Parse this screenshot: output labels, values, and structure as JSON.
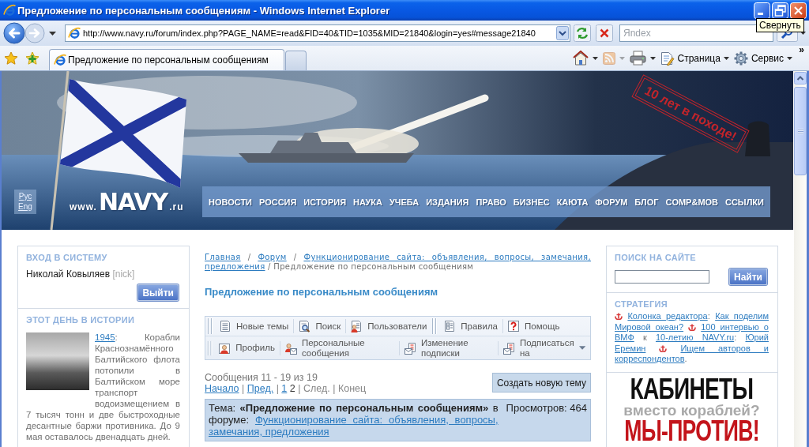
{
  "window": {
    "title": "Предложение по персональным сообщениям - Windows Internet Explorer",
    "tooltip": "Свернуть"
  },
  "address_bar": {
    "url": "http://www.navy.ru/forum/index.php?PAGE_NAME=read&FID=40&TID=1035&MID=21840&login=yes#message21840"
  },
  "search": {
    "placeholder": "Яndex"
  },
  "tabs": [
    {
      "label": "Предложение по персональным сообщениям",
      "selected": true
    }
  ],
  "command_bar": {
    "items": [
      {
        "kind": "home",
        "disabled": false
      },
      {
        "kind": "feeds",
        "disabled": true
      },
      {
        "kind": "print",
        "disabled": false
      },
      {
        "kind": "page",
        "label": "Страница",
        "disabled": false
      },
      {
        "kind": "tools",
        "label": "Сервис",
        "disabled": false
      }
    ],
    "overflow": "»"
  },
  "banner": {
    "stamp": "10 лет в походе!",
    "languages": [
      {
        "label": "Рус"
      },
      {
        "label": "Eng"
      }
    ],
    "logo": {
      "prefix": "www.",
      "name": "NAVY",
      "suffix": ".ru"
    },
    "nav": [
      "НОВОСТИ",
      "РОССИЯ",
      "ИСТОРИЯ",
      "НАУКА",
      "УЧЕБА",
      "ИЗДАНИЯ",
      "ПРАВО",
      "БИЗНЕС",
      "КАЮТА",
      "ФОРУМ",
      "БЛОГ",
      "COMP&MOB",
      "ССЫЛКИ"
    ]
  },
  "left_sidebar": {
    "login": {
      "heading": "ВХОД В СИСТЕМУ",
      "user": "Николай Ковыляев",
      "nick": "[nick]",
      "button": "Выйти"
    },
    "history": {
      "heading": "ЭТОТ ДЕНЬ В ИСТОРИИ",
      "entries": [
        {
          "beside_photo": [
            {
              "kind": "link",
              "text": "1945"
            },
            {
              "kind": "text",
              "text": ": Корабли Краснознамённого Балтийского флота потопили в Балтийском море транспорт водоизмещением в"
            }
          ],
          "below_photo": "7 тысяч тонн и две быстроходные десантные баржи противника. До 9 мая оставалось двенадцать дней."
        }
      ]
    }
  },
  "forum": {
    "breadcrumb": [
      {
        "kind": "link",
        "text": "Главная"
      },
      {
        "kind": "text",
        "text": " / "
      },
      {
        "kind": "link",
        "text": "Форум"
      },
      {
        "kind": "text",
        "text": " / "
      },
      {
        "kind": "link",
        "text": "Функционирование сайта: объявления, вопросы, замечания,"
      },
      {
        "kind": "link",
        "text": "предложения"
      },
      {
        "kind": "text",
        "text": " / Предложение по персональным сообщениям"
      }
    ],
    "title": "Предложение по персональным сообщениям",
    "toolbar": [
      {
        "groups": [
          [
            {
              "kind": "topics",
              "label": "Новые темы"
            },
            {
              "kind": "search",
              "label": "Поиск"
            },
            {
              "kind": "users",
              "label": "Пользователи"
            }
          ],
          [
            {
              "kind": "rules",
              "label": "Правила"
            },
            {
              "kind": "help",
              "label": "Помощь"
            }
          ]
        ]
      },
      {
        "more": true,
        "groups": [
          [
            {
              "kind": "profile",
              "label": "Профиль"
            },
            {
              "kind": "messages",
              "label": "Персональные сообщения"
            },
            {
              "kind": "subscription",
              "label": "Изменение подписки"
            },
            {
              "kind": "subscription",
              "label": "Подписаться на"
            }
          ]
        ]
      }
    ],
    "messages_count": "Сообщения 11 - 19 из 19",
    "pager": [
      {
        "kind": "link",
        "text": "Начало"
      },
      {
        "kind": "text",
        "text": " | "
      },
      {
        "kind": "link",
        "text": "Пред."
      },
      {
        "kind": "text",
        "text": " | "
      },
      {
        "kind": "link",
        "text": "1"
      },
      {
        "kind": "current",
        "text": "2"
      },
      {
        "kind": "text",
        "text": " | След. | Конец"
      }
    ],
    "new_topic_button": "Создать новую тему",
    "topic": {
      "parts": [
        {
          "kind": "text",
          "text": "Тема: "
        },
        {
          "kind": "bold",
          "text": "«Предложение по персональным сообщениям»"
        },
        {
          "kind": "text",
          "text": " в форуме: "
        },
        {
          "kind": "link",
          "text": "Функционирование сайта: объявления, вопросы,"
        },
        {
          "kind": "link",
          "text": "замечания, предложения"
        }
      ],
      "views": "Просмотров: 464"
    }
  },
  "right_sidebar": {
    "search": {
      "heading": "ПОИСК НА САЙТЕ",
      "button": "Найти"
    },
    "strategy": {
      "heading": "СТРАТЕГИЯ",
      "parts": [
        {
          "kind": "icon"
        },
        {
          "kind": "link",
          "text": "Колонка редактора"
        },
        {
          "kind": "text",
          "text": ": "
        },
        {
          "kind": "link",
          "text": "Как поделим"
        },
        {
          "kind": "link",
          "text": "Мировой океан?"
        },
        {
          "kind": "icon"
        },
        {
          "kind": "link",
          "text": "100 интервью о"
        },
        {
          "kind": "link",
          "text": "ВМФ"
        },
        {
          "kind": "text",
          "text": " к "
        },
        {
          "kind": "link",
          "text": "10-летию NAVY.ru"
        },
        {
          "kind": "text",
          "text": ": "
        },
        {
          "kind": "link",
          "text": "Юрий"
        },
        {
          "kind": "link",
          "text": "Еремин"
        },
        {
          "kind": "icon"
        },
        {
          "kind": "link",
          "text": "Ищем авторов и"
        },
        {
          "kind": "link",
          "text": "корреспондентов"
        },
        {
          "kind": "text",
          "text": "."
        }
      ]
    }
  },
  "ad": {
    "lines": [
      {
        "kind": "headline",
        "text": "КАБИНЕТЫ"
      },
      {
        "kind": "subline",
        "text": "вместо кораблей?"
      },
      {
        "kind": "slogan",
        "text": "МЫ-ПРОТИВ!"
      }
    ]
  }
}
